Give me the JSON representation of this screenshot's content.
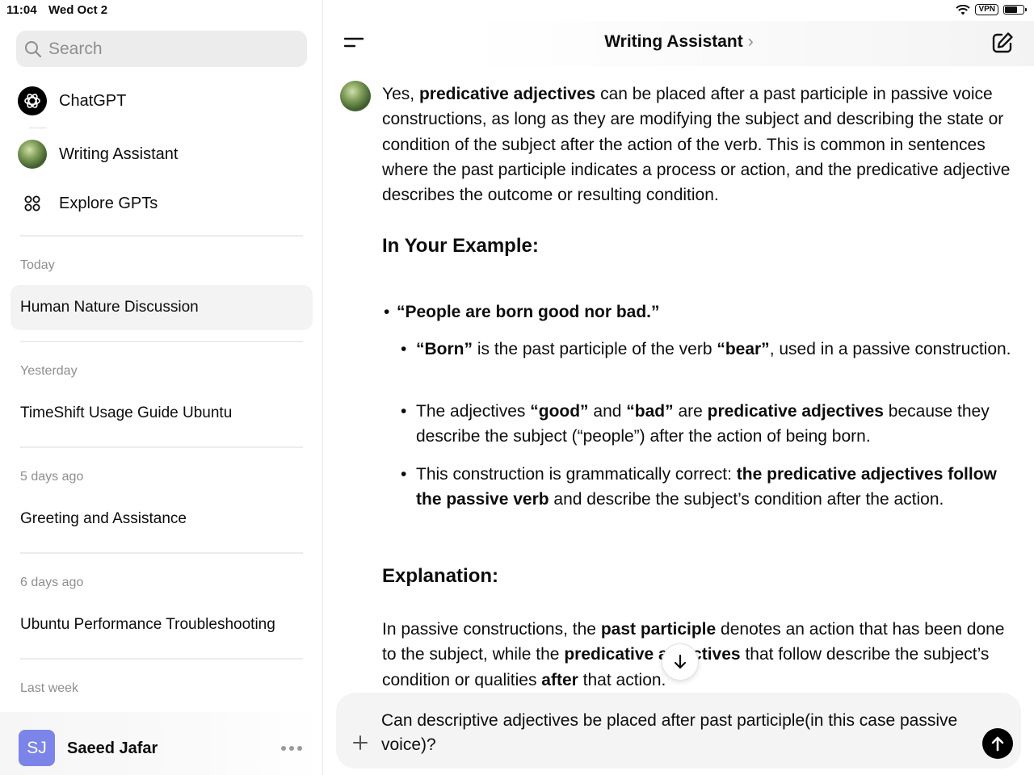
{
  "status_bar": {
    "time": "11:04",
    "date": "Wed Oct 2",
    "vpn_label": "VPN",
    "battery_level": 0.7
  },
  "sidebar": {
    "search_placeholder": "Search",
    "nav": [
      {
        "label": "ChatGPT",
        "icon": "chatgpt-logo-icon"
      },
      {
        "label": "Writing Assistant",
        "icon": "writing-assistant-avatar"
      },
      {
        "label": "Explore GPTs",
        "icon": "grid-icon"
      }
    ],
    "sections": [
      {
        "label": "Today",
        "items": [
          "Human Nature Discussion"
        ]
      },
      {
        "label": "Yesterday",
        "items": [
          "TimeShift Usage Guide Ubuntu"
        ]
      },
      {
        "label": "5 days ago",
        "items": [
          "Greeting and Assistance"
        ]
      },
      {
        "label": "6 days ago",
        "items": [
          "Ubuntu Performance Troubleshooting"
        ]
      },
      {
        "label": "Last week",
        "items": []
      }
    ],
    "profile": {
      "initials": "SJ",
      "name": "Saeed Jafar",
      "avatar_color": "#7b84e8"
    }
  },
  "header": {
    "title": "Writing Assistant",
    "chevron": "›"
  },
  "message": {
    "intro_1": "Yes, ",
    "intro_bold": "predicative adjectives",
    "intro_2": " can be placed after a past participle in passive voice constructions, as long as they are modifying the subject and describing the state or condition of the subject after the action of the verb. This is common in sentences where the past participle indicates a process or action, and the predicative adjective describes the outcome or resulting condition.",
    "heading_example": "In Your Example:",
    "example_sentence": "“People are born good nor bad.”",
    "sub1_b1": "“Born”",
    "sub1_t1": " is the past participle of the verb ",
    "sub1_b2": "“bear”",
    "sub1_t2": ", used in a passive construction.",
    "sub2_t1": "The adjectives ",
    "sub2_b1": "“good”",
    "sub2_t2": " and ",
    "sub2_b2": "“bad”",
    "sub2_t3": " are ",
    "sub2_b3": "predicative adjectives",
    "sub2_t4": " because they describe the subject (“people”) after the action of being born.",
    "sub3_t1": "This construction is grammatically correct: ",
    "sub3_b1": "the predicative adjectives follow the passive verb",
    "sub3_t2": " and describe the subject’s condition after the action.",
    "heading_explanation": "Explanation:",
    "exp_t1": "In passive constructions, the ",
    "exp_b1": "past participle",
    "exp_t2": " denotes an action that has been done to the subject, while the ",
    "exp_b2": "predicative adjectives",
    "exp_t3": " that follow describe the subject’s condition or qualities ",
    "exp_b3": "after",
    "exp_t4": " that action."
  },
  "composer": {
    "text": "Can descriptive adjectives be placed after past participle(in this case passive voice)?"
  }
}
